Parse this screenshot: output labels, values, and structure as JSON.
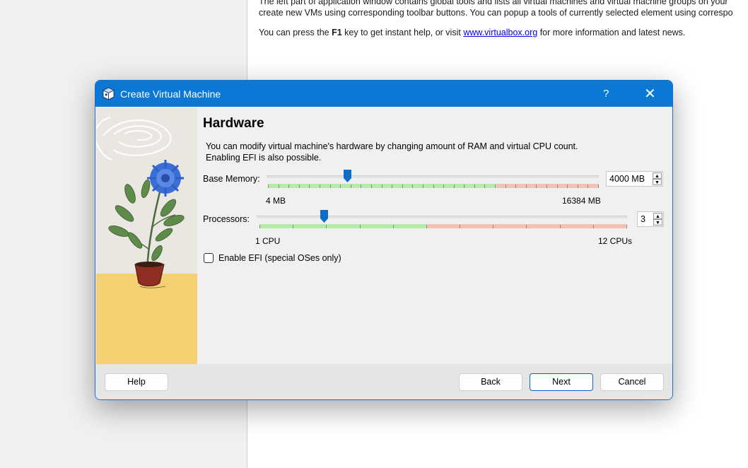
{
  "background": {
    "lines": [
      "The left part of application window contains global tools and lists all virtual machines and virtual machine groups on your",
      "create new VMs using corresponding toolbar buttons. You can popup a tools of currently selected element using correspo"
    ],
    "help_pre": "You can press the ",
    "help_key": "F1",
    "help_mid": " key to get instant help, or visit ",
    "help_link": "www.virtualbox.org",
    "help_post": " for more information and latest news."
  },
  "dialog": {
    "title": "Create Virtual Machine",
    "help_glyph": "?",
    "close_glyph": "✕",
    "heading": "Hardware",
    "description_lines": [
      "You can modify virtual machine's hardware by changing amount of RAM and virtual CPU count.",
      "Enabling EFI is also possible."
    ],
    "memory": {
      "label": "Base Memory:",
      "min_label": "4 MB",
      "max_label": "16384 MB",
      "value": "4000 MB",
      "position": 0.244,
      "recommended_fraction": 0.69
    },
    "processors": {
      "label": "Processors:",
      "min_label": "1 CPU",
      "max_label": "12 CPUs",
      "value": "3",
      "position": 0.182,
      "recommended_fraction": 0.455
    },
    "efi": {
      "label": "Enable EFI (special OSes only)",
      "checked": false
    },
    "buttons": {
      "help": "Help",
      "back": "Back",
      "next": "Next",
      "cancel": "Cancel"
    },
    "colors": {
      "titlebar": "#0a78d4",
      "slider_ok": "#b6ecaa",
      "slider_warn": "#f3c2b0",
      "handle": "#0f6cc9"
    }
  }
}
